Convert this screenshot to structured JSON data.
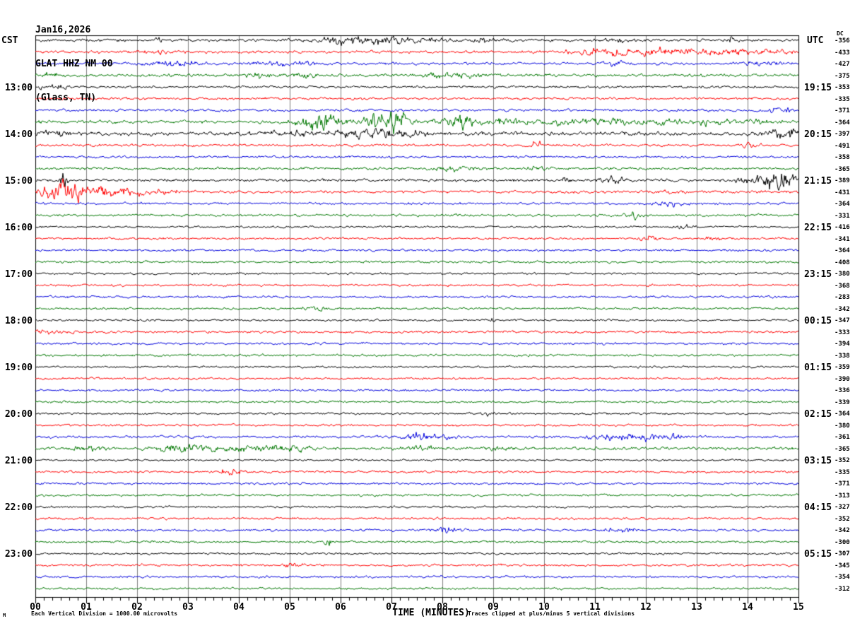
{
  "title": {
    "date": "Jan16,2026",
    "station": "GLAT HHZ NM 00",
    "location": "(Glass, TN)"
  },
  "axes": {
    "left_header": "CST",
    "right_header": "UTC",
    "dc_header": "DC",
    "xlabel": "TIME (MINUTES)"
  },
  "footer": {
    "left_mark": "M",
    "scale_note": "Each Vertical Division = 1000.00 microvolts",
    "clip_note": "Traces clipped at plus/minus 5 vertical divisions"
  },
  "colors": {
    "trace_cycle": [
      "#000000",
      "#ff0000",
      "#0000dd",
      "#007700"
    ],
    "grid": "#808080",
    "border": "#000000"
  },
  "chart_data": {
    "type": "line",
    "subtype": "helicorder-seismogram",
    "title": "GLAT HHZ NM 00 (Glass, TN) Jan16,2026",
    "xlabel": "TIME (MINUTES)",
    "x_range_minutes": [
      0,
      15
    ],
    "minutes_per_row": 15,
    "rows_per_hour": 4,
    "clip_divisions": 5,
    "microvolts_per_division": 1000.0,
    "x_tick_labels": [
      "00",
      "01",
      "02",
      "03",
      "04",
      "05",
      "06",
      "07",
      "08",
      "09",
      "10",
      "11",
      "12",
      "13",
      "14",
      "15"
    ],
    "cst_hour_labels": [
      "13:00",
      "14:00",
      "15:00",
      "16:00",
      "17:00",
      "18:00",
      "19:00",
      "20:00",
      "21:00",
      "22:00",
      "23:00"
    ],
    "utc_hour_labels": [
      "19:15",
      "20:15",
      "21:15",
      "22:15",
      "23:15",
      "00:15",
      "01:15",
      "02:15",
      "03:15",
      "04:15",
      "05:15"
    ],
    "rows": [
      {
        "c": 0,
        "dc": -356,
        "a": 2.6,
        "e": [
          [
            2.45,
            0.05,
            6
          ],
          [
            5.9,
            0.4,
            4
          ],
          [
            6.5,
            0.5,
            5
          ],
          [
            7.1,
            0.4,
            5
          ],
          [
            7.7,
            0.3,
            4
          ],
          [
            8.9,
            0.3,
            3
          ],
          [
            11.5,
            0.3,
            3
          ],
          [
            13.68,
            0.05,
            11
          ]
        ]
      },
      {
        "c": 1,
        "dc": -433,
        "a": 2.6,
        "e": [
          [
            2.5,
            0.3,
            2
          ],
          [
            10.9,
            0.5,
            4
          ],
          [
            11.6,
            0.5,
            4
          ],
          [
            12.2,
            0.5,
            4
          ],
          [
            12.9,
            0.4,
            3
          ],
          [
            13.5,
            0.4,
            4
          ],
          [
            14.3,
            0.5,
            3
          ]
        ]
      },
      {
        "c": 2,
        "dc": -427,
        "a": 2.4,
        "e": [
          [
            2.5,
            0.3,
            4
          ],
          [
            3.0,
            0.25,
            3
          ],
          [
            4.6,
            0.35,
            4
          ],
          [
            5.3,
            0.2,
            3
          ],
          [
            11.4,
            0.2,
            3
          ],
          [
            14.3,
            0.4,
            3
          ]
        ]
      },
      {
        "c": 3,
        "dc": -375,
        "a": 2.6,
        "e": [
          [
            0.3,
            0.2,
            3
          ],
          [
            4.4,
            0.2,
            5
          ],
          [
            5.3,
            0.3,
            3
          ],
          [
            7.8,
            0.4,
            3
          ],
          [
            8.5,
            0.3,
            3
          ]
        ]
      },
      {
        "c": 0,
        "dc": -353,
        "a": 2.3,
        "e": [
          [
            0.35,
            0.3,
            4
          ]
        ]
      },
      {
        "c": 1,
        "dc": -335,
        "a": 2.3,
        "e": []
      },
      {
        "c": 2,
        "dc": -371,
        "a": 2.3,
        "e": [
          [
            14.6,
            0.3,
            3
          ]
        ]
      },
      {
        "c": 3,
        "dc": -364,
        "a": 2.8,
        "e": [
          [
            5.45,
            0.3,
            12
          ],
          [
            5.8,
            0.3,
            8
          ],
          [
            6.8,
            0.35,
            14
          ],
          [
            7.1,
            0.3,
            10
          ],
          [
            8.15,
            0.25,
            9
          ],
          [
            8.5,
            0.25,
            7
          ],
          [
            9.3,
            0.4,
            5
          ],
          [
            10.4,
            0.35,
            5
          ],
          [
            10.9,
            0.3,
            5
          ],
          [
            11.5,
            0.35,
            4
          ],
          [
            12.3,
            0.35,
            4
          ],
          [
            13.3,
            0.4,
            4
          ],
          [
            14.2,
            0.3,
            3
          ]
        ]
      },
      {
        "c": 0,
        "dc": -397,
        "a": 3.5,
        "e": [
          [
            0.3,
            0.3,
            4
          ],
          [
            5.0,
            0.4,
            3
          ],
          [
            6.2,
            0.5,
            5
          ],
          [
            6.9,
            0.4,
            5
          ],
          [
            7.3,
            0.3,
            4
          ],
          [
            14.6,
            0.25,
            6
          ],
          [
            14.9,
            0.08,
            18
          ]
        ]
      },
      {
        "c": 1,
        "dc": -491,
        "a": 2.4,
        "e": [
          [
            9.85,
            0.12,
            6
          ],
          [
            14.05,
            0.2,
            4
          ]
        ]
      },
      {
        "c": 2,
        "dc": -358,
        "a": 2.2,
        "e": []
      },
      {
        "c": 3,
        "dc": -365,
        "a": 2.5,
        "e": [
          [
            8.2,
            0.4,
            3
          ],
          [
            9.9,
            0.2,
            3
          ]
        ]
      },
      {
        "c": 0,
        "dc": -389,
        "a": 2.6,
        "e": [
          [
            0.55,
            0.07,
            16
          ],
          [
            10.45,
            0.07,
            9
          ],
          [
            11.3,
            0.3,
            4
          ],
          [
            13.9,
            0.2,
            4
          ],
          [
            14.35,
            0.25,
            10
          ],
          [
            14.6,
            0.15,
            16
          ],
          [
            14.82,
            0.15,
            10
          ]
        ]
      },
      {
        "c": 1,
        "dc": -431,
        "a": 2.6,
        "e": [
          [
            0.15,
            0.25,
            10
          ],
          [
            0.55,
            0.12,
            26
          ],
          [
            0.75,
            0.3,
            12
          ],
          [
            1.2,
            0.5,
            7
          ],
          [
            2.0,
            0.8,
            4
          ],
          [
            12.4,
            0.3,
            3
          ]
        ]
      },
      {
        "c": 2,
        "dc": -364,
        "a": 2.2,
        "e": [
          [
            12.45,
            0.22,
            5
          ]
        ]
      },
      {
        "c": 3,
        "dc": -331,
        "a": 2.2,
        "e": [
          [
            11.75,
            0.18,
            5
          ]
        ]
      },
      {
        "c": 0,
        "dc": -416,
        "a": 1.9,
        "e": [
          [
            12.7,
            0.2,
            3
          ]
        ]
      },
      {
        "c": 1,
        "dc": -341,
        "a": 2.1,
        "e": [
          [
            12.05,
            0.15,
            4
          ],
          [
            13.35,
            0.15,
            4
          ]
        ]
      },
      {
        "c": 2,
        "dc": -364,
        "a": 2.1,
        "e": []
      },
      {
        "c": 3,
        "dc": -408,
        "a": 2.1,
        "e": []
      },
      {
        "c": 0,
        "dc": -380,
        "a": 1.9,
        "e": []
      },
      {
        "c": 1,
        "dc": -368,
        "a": 2.1,
        "e": []
      },
      {
        "c": 2,
        "dc": -283,
        "a": 2.1,
        "e": []
      },
      {
        "c": 3,
        "dc": -342,
        "a": 2.1,
        "e": [
          [
            5.5,
            0.3,
            3
          ]
        ]
      },
      {
        "c": 0,
        "dc": -347,
        "a": 1.9,
        "e": [
          [
            9.0,
            0.05,
            8
          ]
        ]
      },
      {
        "c": 1,
        "dc": -333,
        "a": 2.2,
        "e": [
          [
            0.3,
            0.4,
            3
          ]
        ]
      },
      {
        "c": 2,
        "dc": -394,
        "a": 2.1,
        "e": []
      },
      {
        "c": 3,
        "dc": -338,
        "a": 2.1,
        "e": []
      },
      {
        "c": 0,
        "dc": -359,
        "a": 1.9,
        "e": []
      },
      {
        "c": 1,
        "dc": -390,
        "a": 2.1,
        "e": []
      },
      {
        "c": 2,
        "dc": -336,
        "a": 2.1,
        "e": []
      },
      {
        "c": 3,
        "dc": -339,
        "a": 2.1,
        "e": []
      },
      {
        "c": 0,
        "dc": -364,
        "a": 1.9,
        "e": [
          [
            8.9,
            0.2,
            3
          ]
        ]
      },
      {
        "c": 1,
        "dc": -380,
        "a": 2.1,
        "e": []
      },
      {
        "c": 2,
        "dc": -361,
        "a": 2.3,
        "e": [
          [
            7.5,
            0.3,
            5
          ],
          [
            8.0,
            0.25,
            4
          ],
          [
            11.3,
            0.4,
            5
          ],
          [
            12.0,
            0.3,
            4
          ],
          [
            12.5,
            0.25,
            3
          ]
        ]
      },
      {
        "c": 3,
        "dc": -365,
        "a": 2.7,
        "e": [
          [
            1.0,
            0.3,
            3
          ],
          [
            2.6,
            0.3,
            4
          ],
          [
            3.2,
            0.4,
            5
          ],
          [
            3.9,
            0.3,
            4
          ],
          [
            4.6,
            0.4,
            4
          ],
          [
            5.2,
            0.3,
            3.5
          ],
          [
            7.6,
            0.3,
            3
          ],
          [
            9.0,
            0.3,
            3
          ]
        ]
      },
      {
        "c": 0,
        "dc": -352,
        "a": 1.9,
        "e": []
      },
      {
        "c": 1,
        "dc": -335,
        "a": 2.1,
        "e": [
          [
            3.85,
            0.18,
            8
          ]
        ]
      },
      {
        "c": 2,
        "dc": -371,
        "a": 2.1,
        "e": []
      },
      {
        "c": 3,
        "dc": -313,
        "a": 2.1,
        "e": []
      },
      {
        "c": 0,
        "dc": -327,
        "a": 1.9,
        "e": []
      },
      {
        "c": 1,
        "dc": -352,
        "a": 2.1,
        "e": []
      },
      {
        "c": 2,
        "dc": -342,
        "a": 2.2,
        "e": [
          [
            8.1,
            0.3,
            5
          ],
          [
            11.5,
            0.25,
            4
          ]
        ]
      },
      {
        "c": 3,
        "dc": -300,
        "a": 2.1,
        "e": [
          [
            5.75,
            0.12,
            5
          ]
        ]
      },
      {
        "c": 0,
        "dc": -307,
        "a": 1.9,
        "e": []
      },
      {
        "c": 1,
        "dc": -345,
        "a": 2.2,
        "e": [
          [
            5.05,
            0.15,
            4
          ]
        ]
      },
      {
        "c": 2,
        "dc": -354,
        "a": 2.1,
        "e": []
      },
      {
        "c": 3,
        "dc": -312,
        "a": 2.0,
        "e": []
      }
    ]
  }
}
